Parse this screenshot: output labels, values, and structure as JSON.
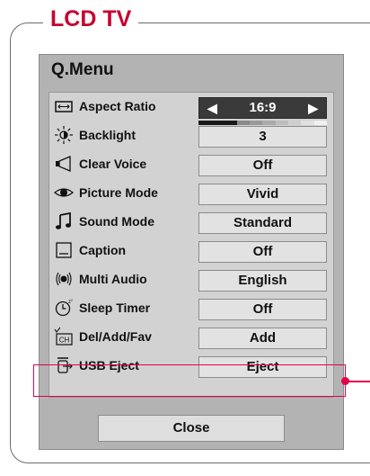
{
  "section_title": "LCD TV",
  "menu": {
    "title": "Q.Menu",
    "close_label": "Close",
    "items": [
      {
        "label": "Aspect Ratio",
        "value": "16:9",
        "icon": "aspect-ratio-icon"
      },
      {
        "label": "Backlight",
        "value": "3",
        "icon": "backlight-icon",
        "level_fraction": 0.3
      },
      {
        "label": "Clear Voice",
        "value": "Off",
        "icon": "clear-voice-icon"
      },
      {
        "label": "Picture Mode",
        "value": "Vivid",
        "icon": "picture-mode-icon"
      },
      {
        "label": "Sound Mode",
        "value": "Standard",
        "icon": "sound-mode-icon"
      },
      {
        "label": "Caption",
        "value": "Off",
        "icon": "caption-icon"
      },
      {
        "label": "Multi Audio",
        "value": "English",
        "icon": "multi-audio-icon"
      },
      {
        "label": "Sleep Timer",
        "value": "Off",
        "icon": "sleep-timer-icon"
      },
      {
        "label": "Del/Add/Fav",
        "value": "Add",
        "icon": "del-add-fav-icon",
        "icon_text": "CH"
      },
      {
        "label": "USB Eject",
        "value": "Eject",
        "icon": "usb-eject-icon"
      }
    ]
  },
  "colors": {
    "accent": "#c8002e",
    "highlight": "#e4004a",
    "menu_bg": "#b3b3b3",
    "selected_value_bg": "#3a3a3a"
  }
}
